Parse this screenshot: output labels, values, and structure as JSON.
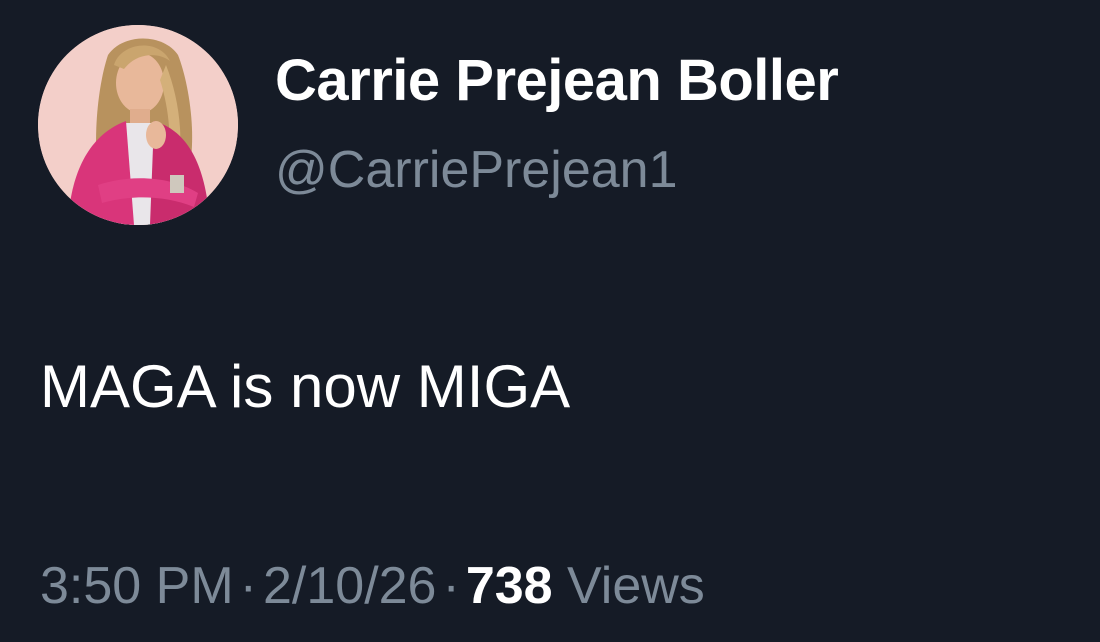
{
  "tweet": {
    "author": {
      "display_name": "Carrie Prejean Boller",
      "handle": "@CarriePrejean1",
      "avatar_icon": "profile-photo"
    },
    "text": "MAGA is now MIGA",
    "time": "3:50 PM",
    "date": "2/10/26",
    "separator": "·",
    "views_count": "738",
    "views_label": "Views"
  },
  "colors": {
    "background": "#151b26",
    "primary_text": "#ffffff",
    "secondary_text": "#7d8a98",
    "avatar_bg": "#f3cfc9",
    "jacket": "#d9357a"
  }
}
